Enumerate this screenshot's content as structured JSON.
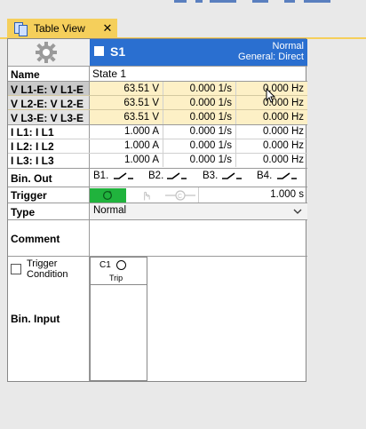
{
  "tab": {
    "title": "Table View",
    "close": "✕"
  },
  "state": {
    "name": "S1",
    "mode_line1": "Normal",
    "mode_line2": "General: Direct"
  },
  "rows": {
    "name_label": "Name",
    "name_value": "State 1",
    "voltage": [
      {
        "label": "V L1-E: V L1-E",
        "amplitude": "63.51 V",
        "rate": "0.000 1/s",
        "freq": "0.000 Hz"
      },
      {
        "label": "V L2-E: V L2-E",
        "amplitude": "63.51 V",
        "rate": "0.000 1/s",
        "freq": "0.000 Hz"
      },
      {
        "label": "V L3-E: V L3-E",
        "amplitude": "63.51 V",
        "rate": "0.000 1/s",
        "freq": "0.000 Hz"
      }
    ],
    "current": [
      {
        "label": "I L1: I L1",
        "amplitude": "1.000 A",
        "rate": "0.000 1/s",
        "freq": "0.000 Hz"
      },
      {
        "label": "I L2: I L2",
        "amplitude": "1.000 A",
        "rate": "0.000 1/s",
        "freq": "0.000 Hz"
      },
      {
        "label": "I L3: I L3",
        "amplitude": "1.000 A",
        "rate": "0.000 1/s",
        "freq": "0.000 Hz"
      }
    ],
    "binout_label": "Bin. Out",
    "binout": [
      "B1.",
      "B2.",
      "B3.",
      "B4."
    ],
    "trigger_label": "Trigger",
    "trigger_time": "1.000 s",
    "type_label": "Type",
    "type_value": "Normal",
    "comment_label": "Comment",
    "trigger_condition_label_1": "Trigger",
    "trigger_condition_label_2": "Condition",
    "bin_input_label": "Bin. Input",
    "bin_input_channel": "C1",
    "bin_input_name": "Trip"
  },
  "colors": {
    "accent": "#2a6fd0",
    "highlight": "#fdf0c6",
    "tab": "#f5cf5b",
    "trigger_green": "#20b33d"
  }
}
